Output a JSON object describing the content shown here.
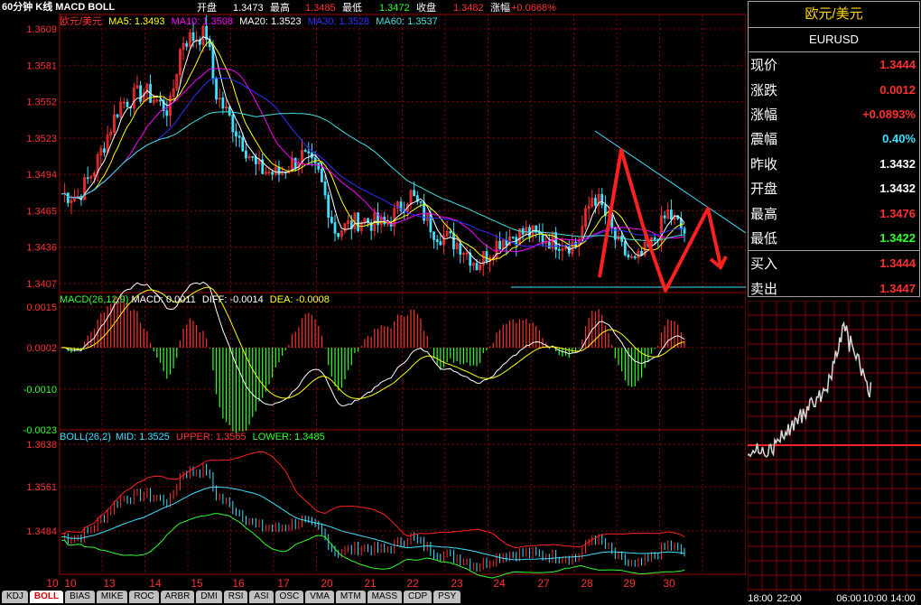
{
  "header": {
    "period": "60分钟 K线 MACD BOLL",
    "open_label": "开盘",
    "open": "1.3473",
    "high_label": "最高",
    "high": "1.3485",
    "low_label": "最低",
    "low": "1.3472",
    "close_label": "收盘",
    "close": "1.3482",
    "change_label": "涨幅",
    "change": "+0.0668%"
  },
  "main_chart": {
    "symbol": "欧元/美元",
    "ma5": "MA5: 1.3493",
    "ma10": "MA10: 1.3508",
    "ma20": "MA20: 1.3523",
    "ma30": "MA30: 1.3528",
    "ma60": "MA60: 1.3537",
    "yticks": [
      "1.3609",
      "1.3581",
      "1.3552",
      "1.3523",
      "1.3494",
      "1.3465",
      "1.3436",
      "1.3407"
    ]
  },
  "macd_panel": {
    "title": "MACD(26,12,9)",
    "macd": "MACD: 0.0011",
    "diff": "DIFF: -0.0014",
    "dea": "DEA: -0.0008",
    "yticks": [
      "0.0015",
      "0.0002",
      "-0.0010",
      "-0.0023"
    ]
  },
  "boll_panel": {
    "title": "BOLL(26,2)",
    "mid": "MID: 1.3525",
    "upper": "UPPER: 1.3565",
    "lower": "LOWER: 1.3485",
    "yticks": [
      "1.3638",
      "1.3561",
      "1.3484"
    ]
  },
  "xaxis": {
    "labels": [
      "10",
      "10",
      "13",
      "14",
      "15",
      "16",
      "17",
      "20",
      "21",
      "22",
      "23",
      "24",
      "27",
      "28",
      "29",
      "30"
    ]
  },
  "tabs": [
    "KDJ",
    "BOLL",
    "BIAS",
    "MIKE",
    "ROC",
    "ARBR",
    "DMI",
    "RSI",
    "ASI",
    "OSC",
    "VMA",
    "MTM",
    "MASS",
    "CDP",
    "PSY"
  ],
  "active_tab": "BOLL",
  "quote_panel": {
    "title": "欧元/美元",
    "symbol": "EURUSD",
    "rows": [
      {
        "label": "现价",
        "value": "1.3444",
        "color": "#ff3030"
      },
      {
        "label": "涨跌",
        "value": "0.0012",
        "color": "#ff3030"
      },
      {
        "label": "涨幅",
        "value": "+0.0893%",
        "color": "#ff3030"
      },
      {
        "label": "震幅",
        "value": "0.40%",
        "color": "#40e0ff"
      },
      {
        "label": "昨收",
        "value": "1.3432",
        "color": "#ffffff"
      },
      {
        "label": "开盘",
        "value": "1.3432",
        "color": "#ffffff"
      },
      {
        "label": "最高",
        "value": "1.3476",
        "color": "#ff3030"
      },
      {
        "label": "最低",
        "value": "1.3422",
        "color": "#30ff30"
      },
      {
        "label": "买入",
        "value": "1.3444",
        "color": "#ff3030"
      },
      {
        "label": "卖出",
        "value": "1.3447",
        "color": "#ff3030"
      }
    ]
  },
  "mini_chart": {
    "xlabels": [
      "18:00",
      "22:00",
      "06:00",
      "10:00",
      "14:00"
    ]
  },
  "colors": {
    "up": "#ff3030",
    "down": "#40e0ff",
    "grid": "#8b0000",
    "ma5": "#ffffff",
    "ma10": "#ffff00",
    "ma20": "#ff00ff",
    "ma30": "#3030ff",
    "ma60": "#40e0e0"
  }
}
